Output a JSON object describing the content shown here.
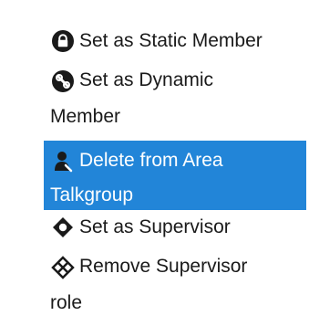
{
  "menu": {
    "items": [
      {
        "icon": "lock-icon",
        "line1": "Set as Static Member",
        "line2": ""
      },
      {
        "icon": "wrench-gear-icon",
        "line1": "Set as Dynamic",
        "line2": "Member"
      },
      {
        "icon": "person-remove-icon",
        "line1": "Delete from Area",
        "line2": "Talkgroup",
        "selected": true
      },
      {
        "icon": "supervisor-star-icon",
        "line1": "Set as Supervisor",
        "line2": ""
      },
      {
        "icon": "remove-supervisor-icon",
        "line1": "Remove Supervisor",
        "line2": "role"
      }
    ]
  },
  "colors": {
    "selected_background": "#2285d8",
    "text": "#1a1a1a",
    "selected_text": "#ffffff"
  }
}
